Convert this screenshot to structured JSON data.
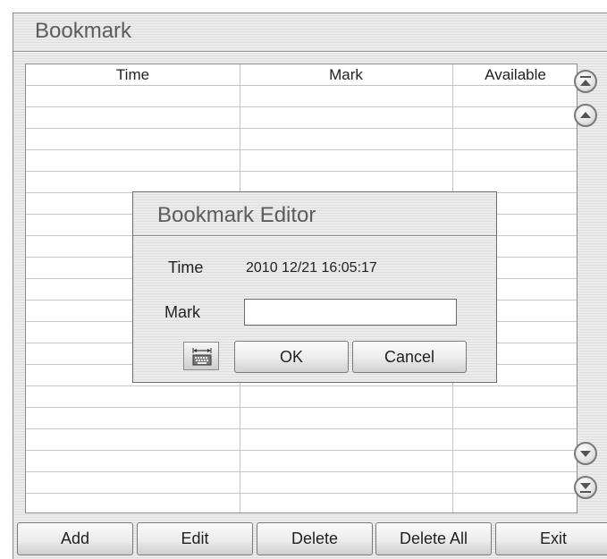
{
  "window": {
    "title": "Bookmark"
  },
  "table": {
    "columns": [
      "Time",
      "Mark",
      "Available"
    ],
    "rows": []
  },
  "scroll": {
    "icons": [
      "scroll-top-icon",
      "scroll-up-icon",
      "scroll-down-icon",
      "scroll-bottom-icon"
    ]
  },
  "dialog": {
    "title": "Bookmark Editor",
    "time_label": "Time",
    "time_value": "2010 12/21 16:05:17",
    "mark_label": "Mark",
    "mark_value": "",
    "keyboard_icon": "keyboard-icon",
    "ok_label": "OK",
    "cancel_label": "Cancel"
  },
  "toolbar": {
    "add_label": "Add",
    "edit_label": "Edit",
    "delete_label": "Delete",
    "delete_all_label": "Delete All",
    "exit_label": "Exit"
  }
}
